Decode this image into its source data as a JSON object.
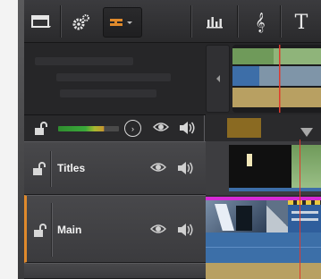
{
  "toolbar": {
    "buttons": [
      {
        "name": "layout-icon"
      },
      {
        "name": "settings-icon"
      },
      {
        "name": "track-view-icon",
        "active": true
      },
      {
        "name": "mixer-icon"
      },
      {
        "name": "music-clef-icon",
        "glyph": "𝄞"
      },
      {
        "name": "title-icon",
        "glyph": "T"
      }
    ]
  },
  "master": {
    "vu_level": 0.75,
    "play_glyph": "›",
    "eye_glyph": "👁",
    "speaker_glyph": "🔊"
  },
  "tracks": [
    {
      "name": "Titles"
    },
    {
      "name": "Main"
    }
  ],
  "colors": {
    "accent": "#e08a2c",
    "playhead": "#e03a2c",
    "clip_magenta": "#d62bd6",
    "clip_blue": "#3c6fa8"
  }
}
